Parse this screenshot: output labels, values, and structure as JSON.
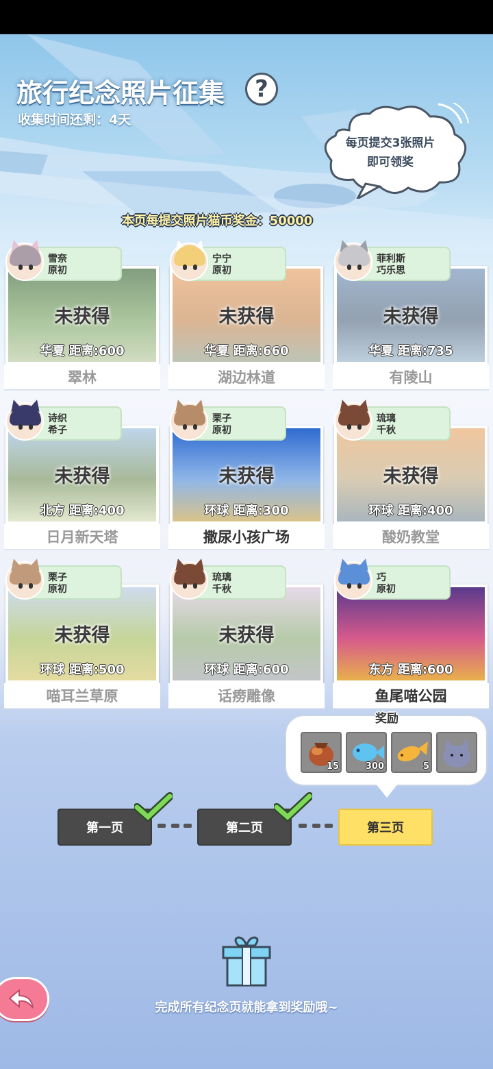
{
  "header": {
    "title": "旅行纪念照片征集",
    "help_icon": "question-mark-icon",
    "countdown": "收集时间还剩：4天",
    "bubble_text": "每页提交3张照片\n即可领奖",
    "bonus_text": "本页每提交照片猫币奖金：50000"
  },
  "cards": [
    {
      "tag": "雪奈\n原初",
      "status": "未获得",
      "info": "华夏 距离:600",
      "name": "翠林",
      "obtained": false,
      "photo_colors": [
        "#3f6a3a",
        "#7ea86a",
        "#b9c9a0"
      ],
      "hair": "#ab9ea8",
      "ear": "#e8c2d0"
    },
    {
      "tag": "宁宁\n原初",
      "status": "未获得",
      "info": "华夏 距离:660",
      "name": "湖边林道",
      "obtained": false,
      "photo_colors": [
        "#e6a267",
        "#c98e5a",
        "#9aa48f"
      ],
      "hair": "#f3cf7a",
      "ear": "#ffffff"
    },
    {
      "tag": "菲利斯\n巧乐思",
      "status": "未获得",
      "info": "华夏 距离:735",
      "name": "有陵山",
      "obtained": false,
      "photo_colors": [
        "#6f8fb6",
        "#5a6f86",
        "#9ab4cb"
      ],
      "hair": "#c8c8cc",
      "ear": "#9aa0aa"
    },
    {
      "tag": "诗织\n希子",
      "status": "未获得",
      "info": "北方 距离:400",
      "name": "日月新天塔",
      "obtained": false,
      "photo_colors": [
        "#9cc0df",
        "#7a9463",
        "#d4ddb5"
      ],
      "hair": "#3a3a6a",
      "ear": "#3a3a6a"
    },
    {
      "tag": "栗子\n原初",
      "status": "未获得",
      "info": "环球 距离:300",
      "name": "撒尿小孩广场",
      "obtained": true,
      "photo_colors": [
        "#2f6bd0",
        "#8fb6e8",
        "#d9c38a"
      ],
      "hair": "#b78c68",
      "ear": "#b78c68"
    },
    {
      "tag": "琉璃\n千秋",
      "status": "未获得",
      "info": "环球 距离:400",
      "name": "酸奶教堂",
      "obtained": false,
      "photo_colors": [
        "#e8a86b",
        "#c4b08a",
        "#7c8f9b"
      ],
      "hair": "#7a4a36",
      "ear": "#7a4a36"
    },
    {
      "tag": "栗子\n原初",
      "status": "未获得",
      "info": "环球 距离:500",
      "name": "喵耳兰草原",
      "obtained": false,
      "photo_colors": [
        "#b3c8e3",
        "#a7bf63",
        "#d6c96e"
      ],
      "hair": "#c09a7a",
      "ear": "#c09a7a"
    },
    {
      "tag": "琉璃\n千秋",
      "status": "未获得",
      "info": "环球 距离:600",
      "name": "话痨雕像",
      "obtained": false,
      "photo_colors": [
        "#d8c6dd",
        "#8fae7a",
        "#a3a7ab"
      ],
      "hair": "#7a4a36",
      "ear": "#7a4a36"
    },
    {
      "tag": "巧\n原初",
      "status": "",
      "info": "东方 距离:600",
      "name": "鱼尾喵公园",
      "obtained": true,
      "photo_colors": [
        "#5a3a8c",
        "#d65a8c",
        "#e8b04c"
      ],
      "hair": "#5b8fd8",
      "ear": "#5b8fd8"
    }
  ],
  "rewards": {
    "title": "奖励",
    "items": [
      {
        "icon": "meat-bag-icon",
        "qty": "15"
      },
      {
        "icon": "blue-fish-icon",
        "qty": "300"
      },
      {
        "icon": "golden-fish-icon",
        "qty": "5"
      },
      {
        "icon": "gray-cat-plush-icon",
        "qty": ""
      }
    ]
  },
  "pages": [
    {
      "label": "第一页",
      "state": "done"
    },
    {
      "label": "第二页",
      "state": "done"
    },
    {
      "label": "第三页",
      "state": "current"
    }
  ],
  "footer": {
    "gift_icon": "gift-box-icon",
    "text": "完成所有纪念页就能拿到奖励哦~",
    "back_icon": "back-arrow-icon"
  },
  "colors": {
    "done_page": "#4a4a4a",
    "current_page": "#ffe066",
    "check": "#7ed957",
    "tag_bg": "#ddf3dd",
    "back_button": "#f47a96"
  }
}
